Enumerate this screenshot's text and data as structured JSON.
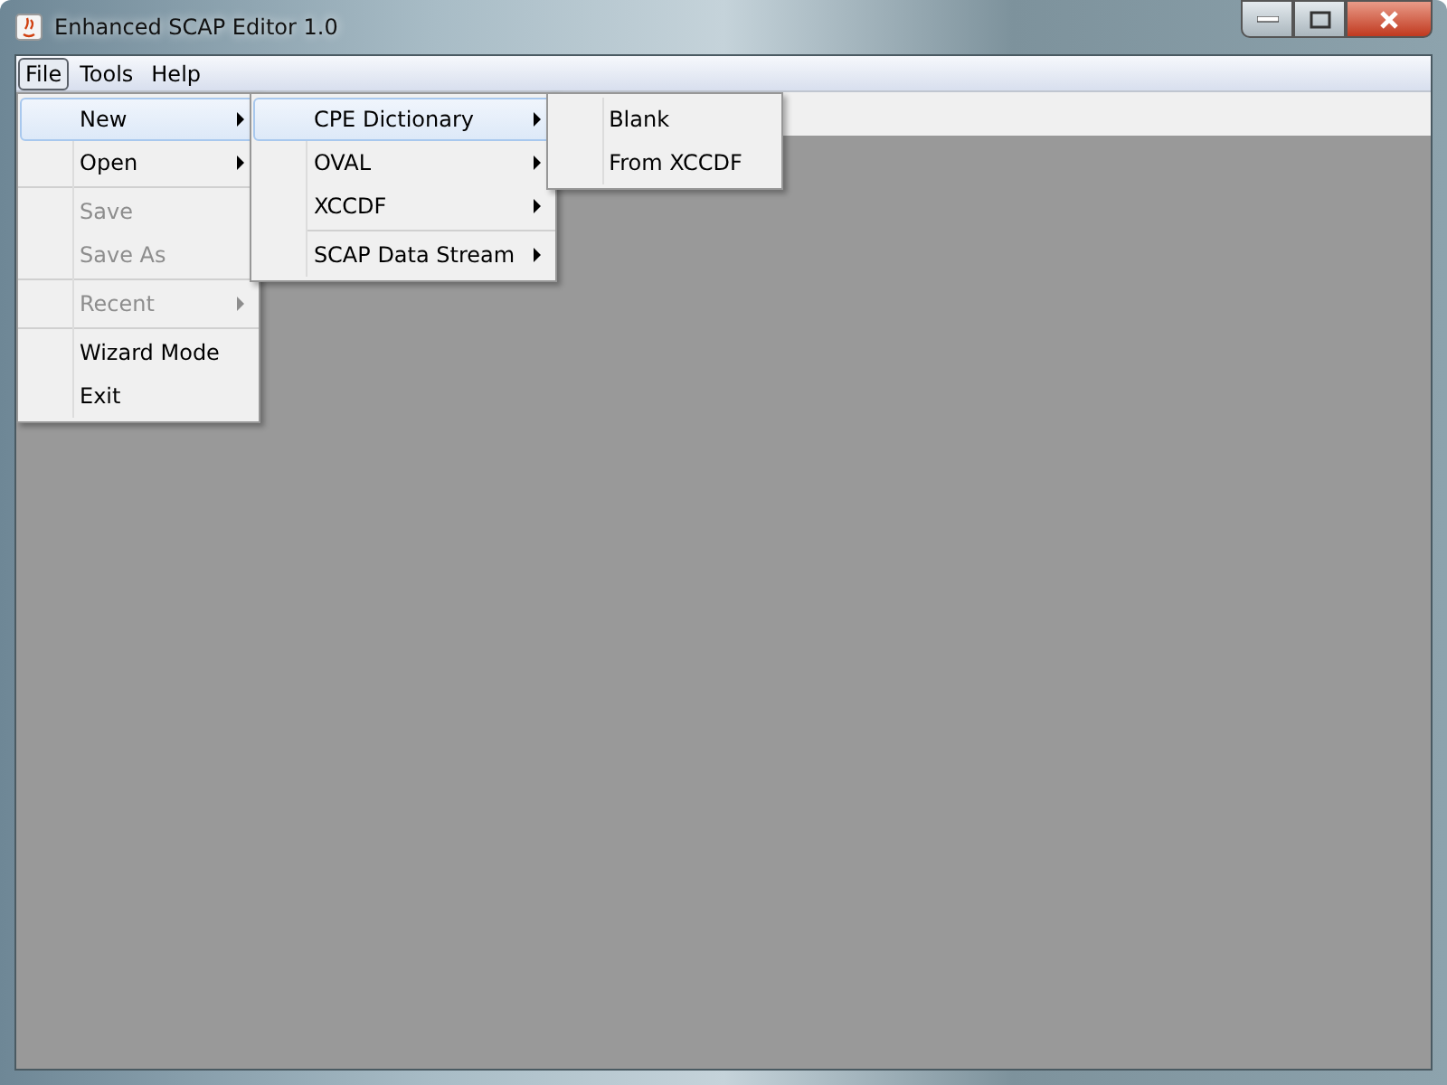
{
  "window": {
    "title": "Enhanced SCAP Editor 1.0"
  },
  "menubar": [
    {
      "label": "File",
      "selected": true
    },
    {
      "label": "Tools",
      "selected": false
    },
    {
      "label": "Help",
      "selected": false
    }
  ],
  "menus": [
    {
      "items": [
        {
          "kind": "item",
          "label": "New",
          "submenu": true,
          "disabled": false,
          "selected": true
        },
        {
          "kind": "item",
          "label": "Open",
          "submenu": true,
          "disabled": false,
          "selected": false
        },
        {
          "kind": "separator"
        },
        {
          "kind": "item",
          "label": "Save",
          "submenu": false,
          "disabled": true,
          "selected": false
        },
        {
          "kind": "item",
          "label": "Save As",
          "submenu": false,
          "disabled": true,
          "selected": false
        },
        {
          "kind": "separator"
        },
        {
          "kind": "item",
          "label": "Recent",
          "submenu": true,
          "disabled": true,
          "selected": false
        },
        {
          "kind": "separator"
        },
        {
          "kind": "item",
          "label": "Wizard Mode",
          "submenu": false,
          "disabled": false,
          "selected": false
        },
        {
          "kind": "item",
          "label": "Exit",
          "submenu": false,
          "disabled": false,
          "selected": false
        }
      ]
    },
    {
      "items": [
        {
          "kind": "item",
          "label": "CPE Dictionary",
          "submenu": true,
          "disabled": false,
          "selected": true
        },
        {
          "kind": "item",
          "label": "OVAL",
          "submenu": true,
          "disabled": false,
          "selected": false
        },
        {
          "kind": "item",
          "label": "XCCDF",
          "submenu": true,
          "disabled": false,
          "selected": false
        },
        {
          "kind": "separator"
        },
        {
          "kind": "item",
          "label": "SCAP Data Stream",
          "submenu": true,
          "disabled": false,
          "selected": false
        }
      ]
    },
    {
      "items": [
        {
          "kind": "item",
          "label": "Blank",
          "submenu": false,
          "disabled": false,
          "selected": false
        },
        {
          "kind": "item",
          "label": "From XCCDF",
          "submenu": false,
          "disabled": false,
          "selected": false
        }
      ]
    }
  ]
}
